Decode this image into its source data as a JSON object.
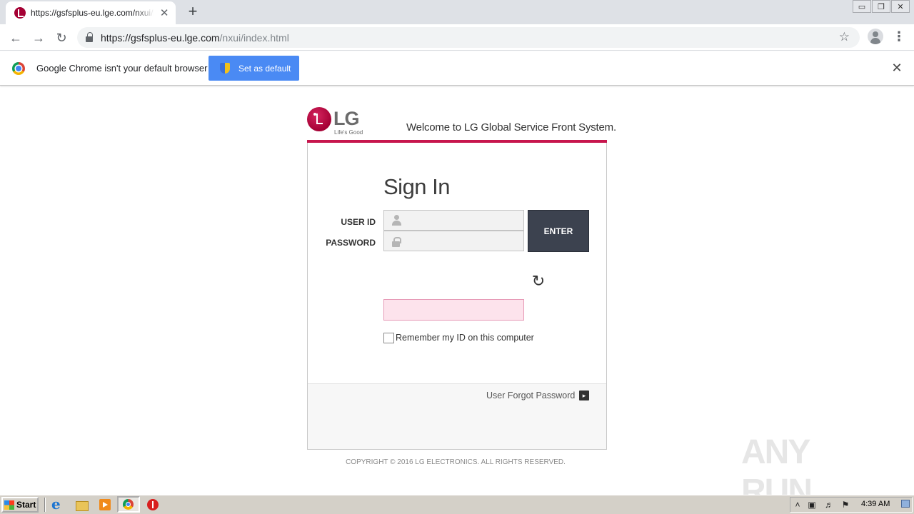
{
  "browser": {
    "tab_title": "https://gsfsplus-eu.lge.com/nxui/ind",
    "tab_close": "✕",
    "new_tab": "+",
    "url_host": "https://gsfsplus-eu.lge.com",
    "url_path": "/nxui/index.html",
    "window_controls": {
      "minimize": "▭",
      "restore": "❐",
      "close": "✕"
    }
  },
  "infobar": {
    "message": "Google Chrome isn't your default browser",
    "button_label": "Set as default",
    "close": "✕"
  },
  "page": {
    "logo_word": "LG",
    "logo_tagline": "Life's Good",
    "welcome": "Welcome to LG Global Service Front System.",
    "brand_color": "#c7164d",
    "signin_title": "Sign In",
    "user_id_label": "USER ID",
    "password_label": "PASSWORD",
    "user_id_value": "",
    "password_value": "",
    "enter_label": "ENTER",
    "refresh_glyph": "↻",
    "captcha_value": "",
    "remember_label": "Remember my ID on this computer",
    "forgot_label": "User Forgot Password",
    "forgot_arrow": "▸",
    "copyright": "COPYRIGHT © 2016 LG ELECTRONICS. ALL RIGHTS RESERVED."
  },
  "watermark": {
    "text": "ANY RUN"
  },
  "taskbar": {
    "start_label": "Start",
    "clock": "4:39 AM",
    "tray_icons": [
      "up-arrow-icon",
      "network-icon",
      "volume-icon",
      "flag-icon"
    ]
  }
}
